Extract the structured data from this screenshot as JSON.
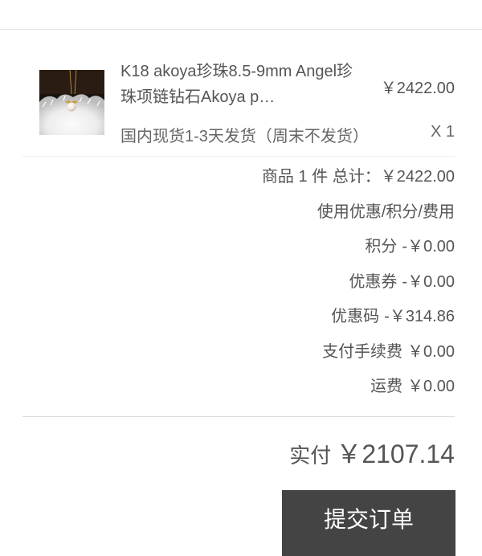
{
  "order_item": {
    "name": "K18 akoya珍珠8.5-9mm Angel珍珠项链钻石Akoya p…",
    "price": "￥2422.00",
    "stock_note": "国内现货1-3天发货（周末不发货）",
    "quantity": "X 1"
  },
  "summary": {
    "count_total": "商品 1 件 总计：￥2422.00",
    "discount_header": "使用优惠/积分/费用",
    "points": {
      "label": "积分",
      "value": "-￥0.00"
    },
    "coupon": {
      "label": "优惠券",
      "value": "-￥0.00"
    },
    "promo_code": {
      "label": "优惠码",
      "value": "-￥314.86"
    },
    "payment_fee": {
      "label": "支付手续费",
      "value": "￥0.00"
    },
    "shipping": {
      "label": "运费",
      "value": "￥0.00"
    }
  },
  "payable": {
    "label": "实付",
    "amount": "￥2107.14"
  },
  "submit": {
    "label": "提交订单"
  },
  "colors": {
    "button_bg": "#444444",
    "text": "#555555"
  }
}
